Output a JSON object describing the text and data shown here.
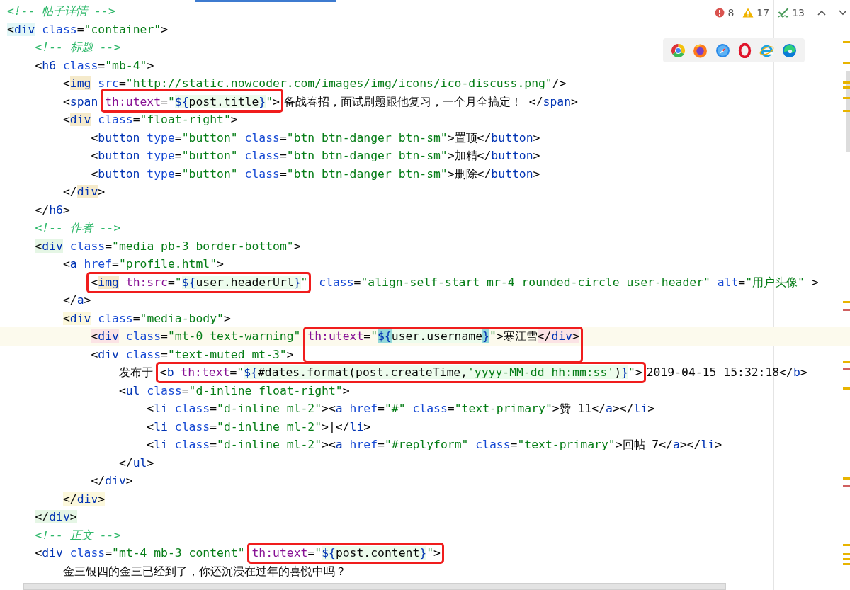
{
  "editor": {
    "lines": [
      {
        "current": false,
        "tokens": [
          {
            "kind": "comment",
            "text": "<!-- 帖子详情 -->"
          }
        ]
      },
      {
        "current": false,
        "tokens": [
          {
            "kind": "punct",
            "text": "<",
            "color": "#e2f7f7"
          },
          {
            "kind": "tag",
            "text": "div",
            "color": "#e2f7f7"
          },
          {
            "kind": "attr",
            "text": " class"
          },
          {
            "kind": "punct",
            "text": "="
          },
          {
            "kind": "string",
            "text": "\"container\""
          },
          {
            "kind": "punct",
            "text": ">"
          }
        ],
        "children": [
          {
            "current": false,
            "tokens": [
              {
                "kind": "comment",
                "text": "<!-- 标题 -->"
              }
            ]
          },
          {
            "current": false,
            "tokens": [
              {
                "kind": "punct",
                "text": "<"
              },
              {
                "kind": "tag",
                "text": "h6"
              },
              {
                "kind": "attr",
                "text": " class"
              },
              {
                "kind": "punct",
                "text": "="
              },
              {
                "kind": "string",
                "text": "\"mb-4\""
              },
              {
                "kind": "punct",
                "text": ">"
              }
            ],
            "children": [
              {
                "current": false,
                "tokens": [
                  {
                    "kind": "punct",
                    "text": "<"
                  },
                  {
                    "kind": "tag",
                    "text": "img",
                    "color": "#f5eacb"
                  },
                  {
                    "kind": "attr",
                    "text": " src"
                  },
                  {
                    "kind": "punct",
                    "text": "="
                  },
                  {
                    "kind": "string",
                    "text": "\"http://static.nowcoder.com/images/img/icons/ico-discuss.png\""
                  },
                  {
                    "kind": "punct",
                    "text": "/>"
                  }
                ]
              },
              {
                "current": false,
                "tokens": [
                  {
                    "kind": "punct",
                    "text": "<"
                  },
                  {
                    "kind": "tag",
                    "text": "span "
                  }
                ],
                "kind": "upward",
                "boxed": [
                  {
                    "kind": "th",
                    "text": "th:utext"
                  },
                  {
                    "kind": "punct",
                    "text": "="
                  },
                  {
                    "kind": "string",
                    "text": "\""
                  },
                  {
                    "kind": "brace",
                    "text": "${"
                  },
                  {
                    "kind": "expr",
                    "text": "post.title"
                  },
                  {
                    "kind": "brace",
                    "text": "}"
                  },
                  {
                    "kind": "string",
                    "text": "\""
                  },
                  {
                    "kind": "punct",
                    "text": ">"
                  }
                ],
                "after": [
                  {
                    "kind": "text",
                    "text": "备战春招，面试刷题跟他复习，一个月全搞定！"
                  },
                  {
                    "kind": "punct",
                    "text": " </"
                  },
                  {
                    "kind": "tag",
                    "text": "span"
                  },
                  {
                    "kind": "punct",
                    "text": ">"
                  }
                ]
              },
              {
                "current": false,
                "tokens": [
                  {
                    "kind": "punct",
                    "text": "<"
                  },
                  {
                    "kind": "tag",
                    "text": "div",
                    "color": "#f5eacb"
                  },
                  {
                    "kind": "attr",
                    "text": " class"
                  },
                  {
                    "kind": "punct",
                    "text": "="
                  },
                  {
                    "kind": "string",
                    "text": "\"float-right\""
                  },
                  {
                    "kind": "punct",
                    "text": ">"
                  }
                ],
                "children": [
                  {
                    "current": false,
                    "tokens": [
                      {
                        "kind": "punct",
                        "text": "<"
                      },
                      {
                        "kind": "tag",
                        "text": "button"
                      },
                      {
                        "kind": "attr",
                        "text": " type"
                      },
                      {
                        "kind": "punct",
                        "text": "="
                      },
                      {
                        "kind": "string",
                        "text": "\"button\""
                      },
                      {
                        "kind": "attr",
                        "text": " class"
                      },
                      {
                        "kind": "punct",
                        "text": "="
                      },
                      {
                        "kind": "string",
                        "text": "\"btn btn-danger btn-sm\""
                      },
                      {
                        "kind": "punct",
                        "text": ">"
                      },
                      {
                        "kind": "text",
                        "text": "置顶"
                      },
                      {
                        "kind": "punct",
                        "text": "</"
                      },
                      {
                        "kind": "tag",
                        "text": "button"
                      },
                      {
                        "kind": "punct",
                        "text": ">"
                      }
                    ]
                  },
                  {
                    "current": false,
                    "tokens": [
                      {
                        "kind": "punct",
                        "text": "<"
                      },
                      {
                        "kind": "tag",
                        "text": "button"
                      },
                      {
                        "kind": "attr",
                        "text": " type"
                      },
                      {
                        "kind": "punct",
                        "text": "="
                      },
                      {
                        "kind": "string",
                        "text": "\"button\""
                      },
                      {
                        "kind": "attr",
                        "text": " class"
                      },
                      {
                        "kind": "punct",
                        "text": "="
                      },
                      {
                        "kind": "string",
                        "text": "\"btn btn-danger btn-sm\""
                      },
                      {
                        "kind": "punct",
                        "text": ">"
                      },
                      {
                        "kind": "text",
                        "text": "加精"
                      },
                      {
                        "kind": "punct",
                        "text": "</"
                      },
                      {
                        "kind": "tag",
                        "text": "button"
                      },
                      {
                        "kind": "punct",
                        "text": ">"
                      }
                    ]
                  },
                  {
                    "current": false,
                    "tokens": [
                      {
                        "kind": "punct",
                        "text": "<"
                      },
                      {
                        "kind": "tag",
                        "text": "button"
                      },
                      {
                        "kind": "attr",
                        "text": " type"
                      },
                      {
                        "kind": "punct",
                        "text": "="
                      },
                      {
                        "kind": "string",
                        "text": "\"button\""
                      },
                      {
                        "kind": "attr",
                        "text": " class"
                      },
                      {
                        "kind": "punct",
                        "text": "="
                      },
                      {
                        "kind": "string",
                        "text": "\"btn btn-danger btn-sm\""
                      },
                      {
                        "kind": "punct",
                        "text": ">"
                      },
                      {
                        "kind": "text",
                        "text": "删除"
                      },
                      {
                        "kind": "punct",
                        "text": "</"
                      },
                      {
                        "kind": "tag",
                        "text": "button"
                      },
                      {
                        "kind": "punct",
                        "text": ">"
                      }
                    ]
                  }
                ]
              },
              {
                "current": false,
                "tokens": [
                  {
                    "kind": "punct",
                    "text": "</"
                  },
                  {
                    "kind": "tag",
                    "text": "div",
                    "color": "#f5eacb"
                  },
                  {
                    "kind": "punct",
                    "text": ">"
                  }
                ]
              }
            ]
          },
          {
            "current": false,
            "tokens": [
              {
                "kind": "punct",
                "text": "</"
              },
              {
                "kind": "tag",
                "text": "h6"
              },
              {
                "kind": "punct",
                "text": ">"
              }
            ]
          },
          {
            "current": false,
            "tokens": [
              {
                "kind": "comment",
                "text": "<!-- 作者 -->"
              }
            ]
          },
          {
            "current": false,
            "tokens": [
              {
                "kind": "punct",
                "text": "<",
                "color": "#e5f6e5"
              },
              {
                "kind": "tag",
                "text": "div",
                "color": "#e5f6e5"
              },
              {
                "kind": "attr",
                "text": " class"
              },
              {
                "kind": "punct",
                "text": "="
              },
              {
                "kind": "string",
                "text": "\"media pb-3 border-bottom\""
              },
              {
                "kind": "punct",
                "text": ">"
              }
            ],
            "children": [
              {
                "current": false,
                "tokens": [
                  {
                    "kind": "punct",
                    "text": "<"
                  },
                  {
                    "kind": "tag",
                    "text": "a"
                  },
                  {
                    "kind": "attr",
                    "text": " href"
                  },
                  {
                    "kind": "punct",
                    "text": "="
                  },
                  {
                    "kind": "string",
                    "text": "\"profile.html\""
                  },
                  {
                    "kind": "punct",
                    "text": ">"
                  }
                ],
                "children": [
                  {
                    "current": false,
                    "kind": "boxed",
                    "boxed": [
                      {
                        "kind": "punct",
                        "text": "<"
                      },
                      {
                        "kind": "tag",
                        "text": "img",
                        "color": "#f5eacb"
                      },
                      {
                        "kind": "th",
                        "text": " th:src"
                      },
                      {
                        "kind": "punct",
                        "text": "="
                      },
                      {
                        "kind": "string",
                        "text": "\""
                      },
                      {
                        "kind": "brace",
                        "text": "${"
                      },
                      {
                        "kind": "expr",
                        "text": "user.headerUrl"
                      },
                      {
                        "kind": "brace",
                        "text": "}"
                      },
                      {
                        "kind": "string",
                        "text": "\""
                      }
                    ],
                    "after": [
                      {
                        "kind": "attr",
                        "text": " class"
                      },
                      {
                        "kind": "punct",
                        "text": "="
                      },
                      {
                        "kind": "string",
                        "text": "\"align-self-start mr-4 rounded-circle user-header\""
                      },
                      {
                        "kind": "attr",
                        "text": " alt"
                      },
                      {
                        "kind": "punct",
                        "text": "="
                      },
                      {
                        "kind": "string",
                        "text": "\"用户头像\""
                      },
                      {
                        "kind": "punct",
                        "text": " >"
                      }
                    ]
                  }
                ]
              },
              {
                "current": false,
                "tokens": [
                  {
                    "kind": "punct",
                    "text": "</"
                  },
                  {
                    "kind": "tag",
                    "text": "a"
                  },
                  {
                    "kind": "punct",
                    "text": ">"
                  }
                ]
              },
              {
                "current": false,
                "tokens": [
                  {
                    "kind": "punct",
                    "text": "<",
                    "color": "#fcf8dc"
                  },
                  {
                    "kind": "tag",
                    "text": "div",
                    "color": "#fcf8dc"
                  },
                  {
                    "kind": "attr",
                    "text": " class"
                  },
                  {
                    "kind": "punct",
                    "text": "="
                  },
                  {
                    "kind": "string",
                    "text": "\"media-body\""
                  },
                  {
                    "kind": "punct",
                    "text": ">"
                  }
                ],
                "children": [
                  {
                    "current": true,
                    "tokens": [
                      {
                        "kind": "punct",
                        "text": "<",
                        "color": "#fbe3e5"
                      },
                      {
                        "kind": "tag",
                        "text": "div",
                        "color": "#fbe3e5"
                      },
                      {
                        "kind": "attr",
                        "text": " class"
                      },
                      {
                        "kind": "punct",
                        "text": "="
                      },
                      {
                        "kind": "string",
                        "text": "\"mt-0 text-warning\" "
                      }
                    ],
                    "kind": "downward",
                    "boxed": [
                      {
                        "kind": "th",
                        "text": "th:utext"
                      },
                      {
                        "kind": "punct",
                        "text": "="
                      },
                      {
                        "kind": "string",
                        "text": "\""
                      },
                      {
                        "kind": "brace",
                        "text": "${",
                        "color": "#93d9d9"
                      },
                      {
                        "kind": "expr",
                        "text": "user.username"
                      },
                      {
                        "kind": "brace",
                        "text": "}",
                        "color": "#93d9d9"
                      },
                      {
                        "kind": "string",
                        "text": "\""
                      },
                      {
                        "kind": "punct",
                        "text": ">"
                      },
                      {
                        "kind": "text",
                        "text": "寒江雪"
                      },
                      {
                        "kind": "punct",
                        "text": "</",
                        "color": "#fbe3e5"
                      },
                      {
                        "kind": "tag",
                        "text": "div",
                        "color": "#fbe3e5"
                      },
                      {
                        "kind": "punct",
                        "text": ">",
                        "color": "#fbe3e5"
                      }
                    ]
                  },
                  {
                    "current": false,
                    "tokens": [
                      {
                        "kind": "punct",
                        "text": "<"
                      },
                      {
                        "kind": "tag",
                        "text": "div"
                      },
                      {
                        "kind": "attr",
                        "text": " class"
                      },
                      {
                        "kind": "punct",
                        "text": "="
                      },
                      {
                        "kind": "string",
                        "text": "\"text-muted mt-3\""
                      },
                      {
                        "kind": "punct",
                        "text": ">"
                      }
                    ],
                    "children": [
                      {
                        "current": false,
                        "tokens": [
                          {
                            "kind": "text",
                            "text": "发布于 "
                          }
                        ],
                        "kind": "boxed",
                        "boxed": [
                          {
                            "kind": "punct",
                            "text": "<"
                          },
                          {
                            "kind": "tag",
                            "text": "b"
                          },
                          {
                            "kind": "th",
                            "text": " th:text"
                          },
                          {
                            "kind": "punct",
                            "text": "="
                          },
                          {
                            "kind": "string",
                            "text": "\""
                          },
                          {
                            "kind": "brace",
                            "text": "${"
                          },
                          {
                            "kind": "expr",
                            "text": "#dates.format(post.createTime,"
                          },
                          {
                            "kind": "exprstring",
                            "text": "'yyyy-MM-dd hh:mm:ss'"
                          },
                          {
                            "kind": "expr",
                            "text": ")"
                          },
                          {
                            "kind": "brace",
                            "text": "}"
                          },
                          {
                            "kind": "string",
                            "text": "\""
                          },
                          {
                            "kind": "punct",
                            "text": ">"
                          }
                        ],
                        "after": [
                          {
                            "kind": "text",
                            "text": "2019-04-15 15:32:18"
                          },
                          {
                            "kind": "punct",
                            "text": "</"
                          },
                          {
                            "kind": "tag",
                            "text": "b"
                          },
                          {
                            "kind": "punct",
                            "text": ">"
                          }
                        ]
                      },
                      {
                        "current": false,
                        "tokens": [
                          {
                            "kind": "punct",
                            "text": "<"
                          },
                          {
                            "kind": "tag",
                            "text": "ul"
                          },
                          {
                            "kind": "attr",
                            "text": " class"
                          },
                          {
                            "kind": "punct",
                            "text": "="
                          },
                          {
                            "kind": "string",
                            "text": "\"d-inline float-right\""
                          },
                          {
                            "kind": "punct",
                            "text": ">"
                          }
                        ],
                        "children": [
                          {
                            "current": false,
                            "tokens": [
                              {
                                "kind": "punct",
                                "text": "<"
                              },
                              {
                                "kind": "tag",
                                "text": "li"
                              },
                              {
                                "kind": "attr",
                                "text": " class"
                              },
                              {
                                "kind": "punct",
                                "text": "="
                              },
                              {
                                "kind": "string",
                                "text": "\"d-inline ml-2\""
                              },
                              {
                                "kind": "punct",
                                "text": "><"
                              },
                              {
                                "kind": "tag",
                                "text": "a"
                              },
                              {
                                "kind": "attr",
                                "text": " href"
                              },
                              {
                                "kind": "punct",
                                "text": "="
                              },
                              {
                                "kind": "string",
                                "text": "\"#\""
                              },
                              {
                                "kind": "attr",
                                "text": " class"
                              },
                              {
                                "kind": "punct",
                                "text": "="
                              },
                              {
                                "kind": "string",
                                "text": "\"text-primary\""
                              },
                              {
                                "kind": "punct",
                                "text": ">"
                              },
                              {
                                "kind": "text",
                                "text": "赞 11"
                              },
                              {
                                "kind": "punct",
                                "text": "</"
                              },
                              {
                                "kind": "tag",
                                "text": "a"
                              },
                              {
                                "kind": "punct",
                                "text": "></"
                              },
                              {
                                "kind": "tag",
                                "text": "li"
                              },
                              {
                                "kind": "punct",
                                "text": ">"
                              }
                            ]
                          },
                          {
                            "current": false,
                            "tokens": [
                              {
                                "kind": "punct",
                                "text": "<"
                              },
                              {
                                "kind": "tag",
                                "text": "li"
                              },
                              {
                                "kind": "attr",
                                "text": " class"
                              },
                              {
                                "kind": "punct",
                                "text": "="
                              },
                              {
                                "kind": "string",
                                "text": "\"d-inline ml-2\""
                              },
                              {
                                "kind": "punct",
                                "text": ">"
                              },
                              {
                                "kind": "text",
                                "text": "|"
                              },
                              {
                                "kind": "punct",
                                "text": "</"
                              },
                              {
                                "kind": "tag",
                                "text": "li"
                              },
                              {
                                "kind": "punct",
                                "text": ">"
                              }
                            ]
                          },
                          {
                            "current": false,
                            "tokens": [
                              {
                                "kind": "punct",
                                "text": "<"
                              },
                              {
                                "kind": "tag",
                                "text": "li"
                              },
                              {
                                "kind": "attr",
                                "text": " class"
                              },
                              {
                                "kind": "punct",
                                "text": "="
                              },
                              {
                                "kind": "string",
                                "text": "\"d-inline ml-2\""
                              },
                              {
                                "kind": "punct",
                                "text": "><"
                              },
                              {
                                "kind": "tag",
                                "text": "a"
                              },
                              {
                                "kind": "attr",
                                "text": " href"
                              },
                              {
                                "kind": "punct",
                                "text": "="
                              },
                              {
                                "kind": "string",
                                "text": "\"#replyform\""
                              },
                              {
                                "kind": "attr",
                                "text": " class"
                              },
                              {
                                "kind": "punct",
                                "text": "="
                              },
                              {
                                "kind": "string",
                                "text": "\"text-primary\""
                              },
                              {
                                "kind": "punct",
                                "text": ">"
                              },
                              {
                                "kind": "text",
                                "text": "回帖 7"
                              },
                              {
                                "kind": "punct",
                                "text": "</"
                              },
                              {
                                "kind": "tag",
                                "text": "a"
                              },
                              {
                                "kind": "punct",
                                "text": "></"
                              },
                              {
                                "kind": "tag",
                                "text": "li"
                              },
                              {
                                "kind": "punct",
                                "text": ">"
                              }
                            ]
                          }
                        ]
                      },
                      {
                        "current": false,
                        "tokens": [
                          {
                            "kind": "punct",
                            "text": "</"
                          },
                          {
                            "kind": "tag",
                            "text": "ul"
                          },
                          {
                            "kind": "punct",
                            "text": ">"
                          }
                        ]
                      }
                    ]
                  },
                  {
                    "current": false,
                    "tokens": [
                      {
                        "kind": "punct",
                        "text": "</"
                      },
                      {
                        "kind": "tag",
                        "text": "div"
                      },
                      {
                        "kind": "punct",
                        "text": ">"
                      }
                    ]
                  }
                ]
              },
              {
                "current": false,
                "tokens": [
                  {
                    "kind": "punct",
                    "text": "</",
                    "color": "#fcf8dc"
                  },
                  {
                    "kind": "tag",
                    "text": "div",
                    "color": "#fcf8dc"
                  },
                  {
                    "kind": "punct",
                    "text": ">",
                    "color": "#fcf8dc"
                  }
                ]
              }
            ]
          },
          {
            "current": false,
            "tokens": [
              {
                "kind": "punct",
                "text": "</",
                "color": "#e5f6e5"
              },
              {
                "kind": "tag",
                "text": "div",
                "color": "#e5f6e5"
              },
              {
                "kind": "punct",
                "text": ">",
                "color": "#e5f6e5"
              }
            ]
          },
          {
            "current": false,
            "tokens": [
              {
                "kind": "comment",
                "text": "<!-- 正文 -->"
              }
            ]
          },
          {
            "current": false,
            "tokens": [
              {
                "kind": "punct",
                "text": "<"
              },
              {
                "kind": "tag",
                "text": "div"
              },
              {
                "kind": "attr",
                "text": " class"
              },
              {
                "kind": "punct",
                "text": "="
              },
              {
                "kind": "string",
                "text": "\"mt-4 mb-3 content\" "
              }
            ],
            "kind": "boxed",
            "boxed": [
              {
                "kind": "th",
                "text": "th:utext"
              },
              {
                "kind": "punct",
                "text": "="
              },
              {
                "kind": "string",
                "text": "\""
              },
              {
                "kind": "brace",
                "text": "${"
              },
              {
                "kind": "expr",
                "text": "post.content"
              },
              {
                "kind": "brace",
                "text": "}"
              },
              {
                "kind": "string",
                "text": "\""
              },
              {
                "kind": "punct",
                "text": ">"
              }
            ],
            "children": [
              {
                "current": false,
                "tokens": [
                  {
                    "kind": "text",
                    "text": "金三银四的金三已经到了，你还沉浸在过年的喜悦中吗？"
                  }
                ]
              }
            ]
          }
        ]
      }
    ]
  },
  "inspections": {
    "errors": "8",
    "warnings": "17",
    "weak_warnings": "13"
  }
}
